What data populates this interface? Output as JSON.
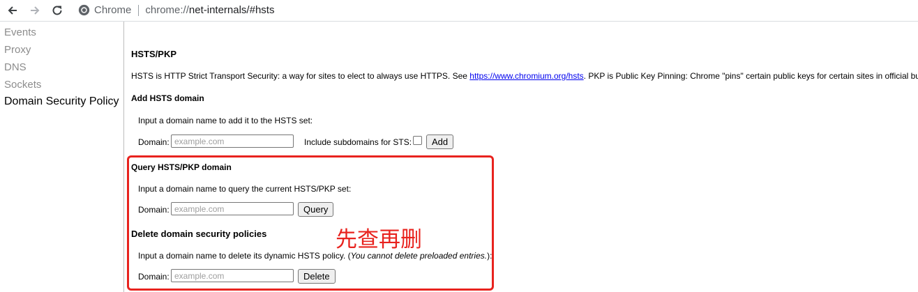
{
  "browser": {
    "origin_label": "Chrome",
    "url_prefix": "chrome://",
    "url_rest": "net-internals/#hsts"
  },
  "sidebar": {
    "items": [
      {
        "label": "Events"
      },
      {
        "label": "Proxy"
      },
      {
        "label": "DNS"
      },
      {
        "label": "Sockets"
      },
      {
        "label": "Domain Security Policy",
        "selected": true
      }
    ]
  },
  "main": {
    "title": "HSTS/PKP",
    "intro_before": "HSTS is HTTP Strict Transport Security: a way for sites to elect to always use HTTPS. See ",
    "intro_link": "https://www.chromium.org/hsts",
    "intro_after": ". PKP is Public Key Pinning: Chrome \"pins\" certain public keys for certain sites in official builds.",
    "add": {
      "heading": "Add HSTS domain",
      "instructions": "Input a domain name to add it to the HSTS set:",
      "domain_label": "Domain:",
      "domain_placeholder": "example.com",
      "subdomains_label": "Include subdomains for STS:",
      "subdomains_checked": false,
      "button_label": "Add"
    },
    "query": {
      "heading": "Query HSTS/PKP domain",
      "instructions": "Input a domain name to query the current HSTS/PKP set:",
      "domain_label": "Domain:",
      "domain_placeholder": "example.com",
      "button_label": "Query"
    },
    "delete": {
      "heading": "Delete domain security policies",
      "instructions_before": "Input a domain name to delete its dynamic HSTS policy. (",
      "instructions_italic": "You cannot delete preloaded entries.",
      "instructions_after": "):",
      "domain_label": "Domain:",
      "domain_placeholder": "example.com",
      "button_label": "Delete"
    }
  },
  "annotation": {
    "text": "先查再删",
    "color": "#e8231e"
  }
}
